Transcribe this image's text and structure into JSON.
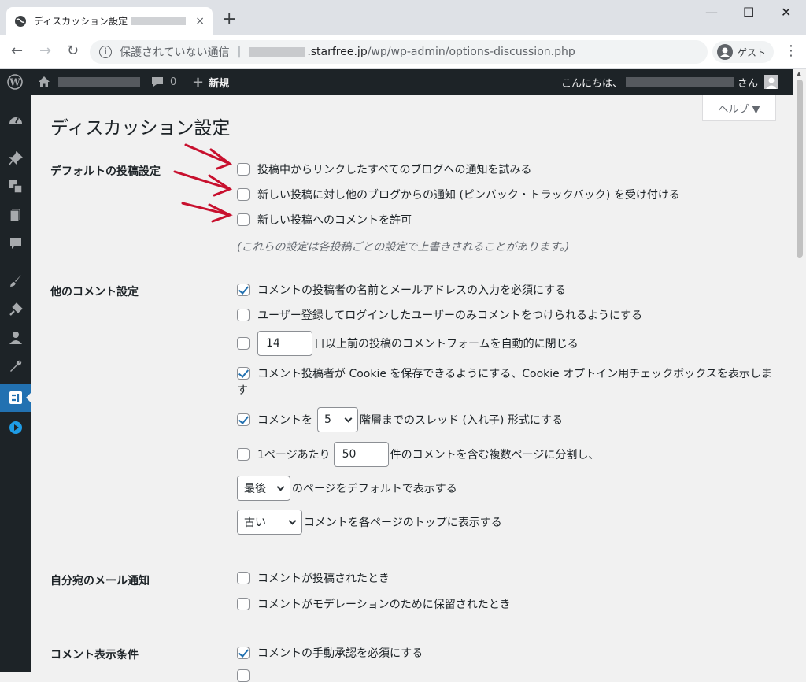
{
  "browser": {
    "tab_title": "ディスカッション設定 ‹",
    "tab_close": "×",
    "new_tab": "+",
    "win_min": "—",
    "win_max": "☐",
    "win_close": "✕",
    "back": "←",
    "forward": "→",
    "reload": "↻",
    "info_icon": "i",
    "security_text": "保護されていない通信",
    "separator": "|",
    "url_host": ".starfree.jp",
    "url_path": "/wp/wp-admin/options-discussion.php",
    "profile_label": "ゲスト",
    "menu": "⋮"
  },
  "adminbar": {
    "comment_count": "0",
    "new_label": "新規",
    "greeting": "こんにちは、",
    "greeting_suffix": "さん"
  },
  "help_label": "ヘルプ ▼",
  "page_title": "ディスカッション設定",
  "sections": {
    "default_post": {
      "label": "デフォルトの投稿設定",
      "opt1": "投稿中からリンクしたすべてのブログへの通知を試みる",
      "opt2": "新しい投稿に対し他のブログからの通知 (ピンバック・トラックバック) を受け付ける",
      "opt3": "新しい投稿へのコメントを許可",
      "note": "(これらの設定は各投稿ごとの設定で上書きされることがあります。)"
    },
    "other_comments": {
      "label": "他のコメント設定",
      "opt1": "コメントの投稿者の名前とメールアドレスの入力を必須にする",
      "opt2": "ユーザー登録してログインしたユーザーのみコメントをつけられるようにする",
      "close_days": "14",
      "close_text": "日以上前の投稿のコメントフォームを自動的に閉じる",
      "cookie_text": "コメント投稿者が Cookie を保存できるようにする、Cookie オプトイン用チェックボックスを表示します",
      "thread_prefix": "コメントを",
      "thread_depth": "5",
      "thread_suffix": "階層までのスレッド (入れ子) 形式にする",
      "paginate_prefix": "1ページあたり",
      "per_page": "50",
      "paginate_suffix": "件のコメントを含む複数ページに分割し、",
      "default_page": "最後",
      "default_page_text": "のページをデフォルトで表示する",
      "order": "古い",
      "order_text": "コメントを各ページのトップに表示する"
    },
    "email_me": {
      "label": "自分宛のメール通知",
      "opt1": "コメントが投稿されたとき",
      "opt2": "コメントがモデレーションのために保留されたとき"
    },
    "appear": {
      "label": "コメント表示条件",
      "opt1": "コメントの手動承認を必須にする"
    }
  },
  "colors": {
    "admin_bar": "#1d2327",
    "accent": "#2271b1",
    "annotation_arrow": "#c8102e"
  }
}
